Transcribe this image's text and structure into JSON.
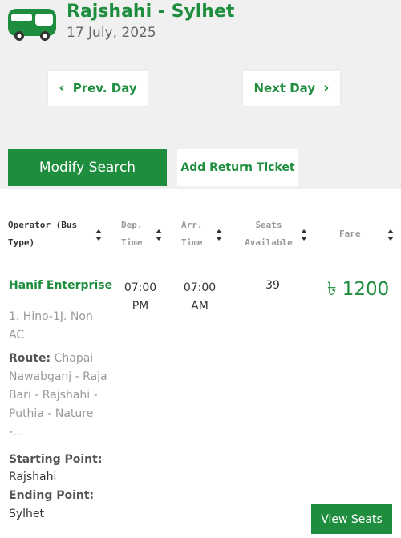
{
  "header": {
    "route": "Rajshahi - Sylhet",
    "date": "17 July, 2025",
    "icon": "bus-icon",
    "brand_color": "#1e8e3e"
  },
  "nav": {
    "prev_label": "Prev. Day",
    "next_label": "Next Day"
  },
  "actions": {
    "modify_label": "Modify Search",
    "return_label": "Add Return Ticket"
  },
  "table": {
    "columns": [
      {
        "line1": "Operator (Bus",
        "line2": "Type)"
      },
      {
        "line1": "Dep.",
        "line2": "Time"
      },
      {
        "line1": "Arr.",
        "line2": "Time"
      },
      {
        "line1": "Seats",
        "line2": "Available"
      },
      {
        "line1": "Fare",
        "line2": ""
      }
    ],
    "rows": [
      {
        "operator": "Hanif Enterprise",
        "bus_type": "1. Hino-1J. Non AC",
        "route_label": "Route:",
        "route_value": "Chapai Nawabganj - Raja Bari - Rajshahi - Puthia - Nature -...",
        "dep_time": "07:00 PM",
        "arr_time": "07:00 AM",
        "seats": "39",
        "fare": "৳ 1200",
        "starting_label": "Starting Point:",
        "starting_value": "Rajshahi",
        "ending_label": "Ending Point:",
        "ending_value": "Sylhet",
        "view_label": "View Seats"
      }
    ]
  }
}
